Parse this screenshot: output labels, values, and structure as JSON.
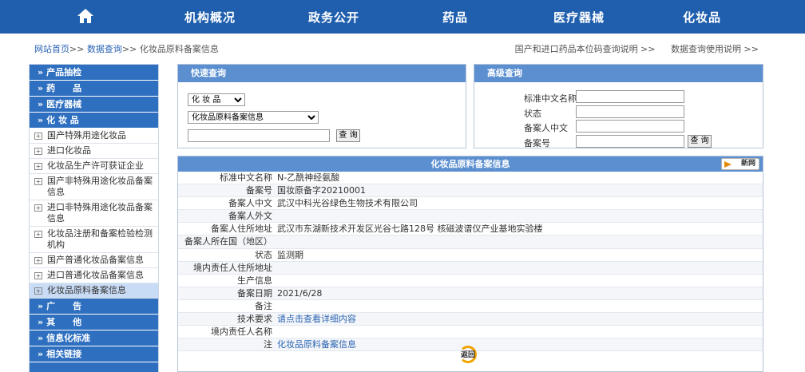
{
  "nav": {
    "items": [
      "机构概况",
      "政务公开",
      "药品",
      "医疗器械",
      "化妆品"
    ]
  },
  "breadcrumb": {
    "home": "网站首页",
    "sep": ">>",
    "query": "数据查询",
    "current": "化妆品原料备案信息"
  },
  "toplinks": [
    "国产和进口药品本位码查询说明 >>",
    "数据查询使用说明 >>"
  ],
  "sidebar": {
    "head1": "产品抽检",
    "head2": "药　　品",
    "head3": "医疗器械",
    "head4": "化 妆 品",
    "subitems": [
      "国产特殊用途化妆品",
      "进口化妆品",
      "化妆品生产许可获证企业",
      "国产非特殊用途化妆品备案信息",
      "进口非特殊用途化妆品备案信息",
      "化妆品注册和备案检验检测机构",
      "国产普通化妆品备案信息",
      "进口普通化妆品备案信息",
      "化妆品原料备案信息"
    ],
    "head5": "广　　告",
    "head6": "其　　他",
    "head7": "信息化标准",
    "head8": "相关链接",
    "marker": "»"
  },
  "quick": {
    "title": "快速查询",
    "category": "化 妆 品",
    "dataset": "化妆品原料备案信息",
    "button": "查 询"
  },
  "advanced": {
    "title": "高级查询",
    "labels": [
      "标准中文名称",
      "状态",
      "备案人中文",
      "备案号"
    ],
    "button": "查 询"
  },
  "detail": {
    "title": "化妆品原料备案信息",
    "refresh": "新网",
    "rows": [
      {
        "k": "标准中文名称",
        "v": "N-乙酰神经氨酸"
      },
      {
        "k": "备案号",
        "v": "国妆原备字20210001"
      },
      {
        "k": "备案人中文",
        "v": "武汉中科光谷绿色生物技术有限公司"
      },
      {
        "k": "备案人外文",
        "v": ""
      },
      {
        "k": "备案人住所地址",
        "v": "武汉市东湖新技术开发区光谷七路128号 核磁波谱仪产业基地实验楼"
      },
      {
        "k": "备案人所在国（地区）",
        "v": ""
      },
      {
        "k": "状态",
        "v": "监测期"
      },
      {
        "k": "境内责任人住所地址",
        "v": ""
      },
      {
        "k": "生产信息",
        "v": ""
      },
      {
        "k": "备案日期",
        "v": "2021/6/28"
      },
      {
        "k": "备注",
        "v": ""
      },
      {
        "k": "技术要求",
        "v": "请点击查看详细内容"
      },
      {
        "k": "境内责任人名称",
        "v": ""
      },
      {
        "k": "注",
        "v": "化妆品原料备案信息"
      }
    ],
    "back": "返回"
  }
}
